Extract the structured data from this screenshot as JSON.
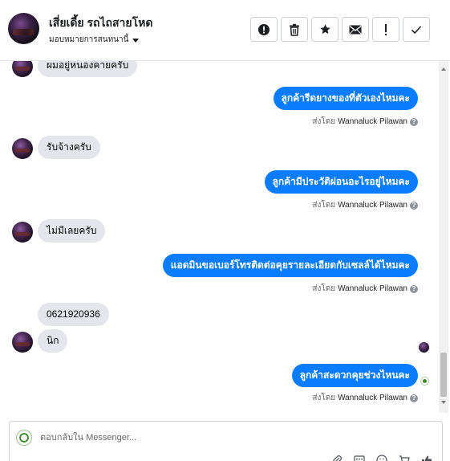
{
  "header": {
    "contact_name": "เสี่ยเดี้ย รถไถสายโหด",
    "assign_label": "มอบหมายการสนทนานี้",
    "tools": [
      {
        "name": "spam-button",
        "icon": "alert-circle-icon"
      },
      {
        "name": "delete-button",
        "icon": "trash-icon"
      },
      {
        "name": "star-button",
        "icon": "star-icon"
      },
      {
        "name": "email-button",
        "icon": "envelope-icon"
      },
      {
        "name": "follow-up-button",
        "icon": "exclamation-icon"
      },
      {
        "name": "done-button",
        "icon": "checkmark-icon"
      }
    ]
  },
  "messages": [
    {
      "from": "contact",
      "text": "ผมอยู่หนองคายครับ"
    },
    {
      "from": "page",
      "text": "ลูกค้ารีดยางของที่ตัวเองไหมคะ",
      "sent_by_prefix": "ส่งโดย",
      "sent_by": "Wannaluck Pilawan"
    },
    {
      "from": "contact",
      "text": "รับจ้างครับ"
    },
    {
      "from": "page",
      "text": "ลูกค้ามีประวัติผ่อนอะไรอยู่ไหมคะ",
      "sent_by_prefix": "ส่งโดย",
      "sent_by": "Wannaluck Pilawan"
    },
    {
      "from": "contact",
      "text": "ไม่มีเลยครับ"
    },
    {
      "from": "page",
      "text": "แอดมินขอเบอร์โทรติดต่อคุยรายละเอียดกับเซลล์ได้ไหมคะ",
      "sent_by_prefix": "ส่งโดย",
      "sent_by": "Wannaluck Pilawan"
    },
    {
      "from": "contact",
      "text": "0621920936"
    },
    {
      "from": "contact",
      "text": "นิก"
    },
    {
      "from": "page",
      "text": "ลูกค้าสะดวกคุยช่วงไหนคะ",
      "sent_by_prefix": "ส่งโดย",
      "sent_by": "Wannaluck Pilawan"
    }
  ],
  "composer": {
    "placeholder": "ตอบกลับใน Messenger...",
    "value": "",
    "tools": [
      "attachment-icon",
      "saved-replies-icon",
      "emoji-icon",
      "shop-icon",
      "like-icon"
    ]
  },
  "colors": {
    "outgoing_bubble": "#0a7cff",
    "incoming_bubble": "#e4e6eb"
  }
}
